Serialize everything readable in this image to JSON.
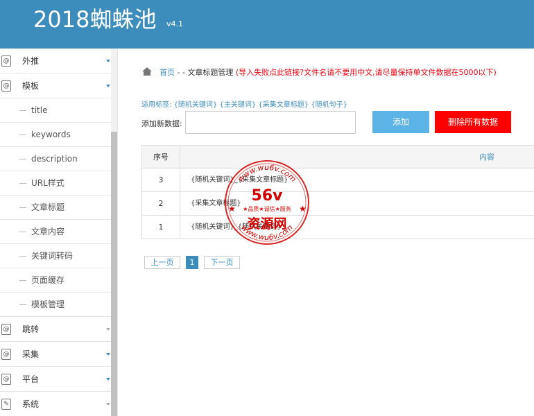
{
  "header": {
    "title": "2018蜘蛛池",
    "version": "v4.1"
  },
  "sidebar": {
    "items": [
      {
        "label": "外推"
      },
      {
        "label": "模板"
      },
      {
        "label": "跳转"
      },
      {
        "label": "采集"
      },
      {
        "label": "平台"
      },
      {
        "label": "系统"
      }
    ],
    "template_sub": [
      "title",
      "keywords",
      "description",
      "URL样式",
      "文章标题",
      "文章内容",
      "关键词转码",
      "页面缓存",
      "模板管理"
    ]
  },
  "breadcrumb": {
    "home": "首页",
    "sep": " - - ",
    "current": "文章标题管理",
    "note": " (导入失败点此链接?文件名请不要用中文,请尽量保持单文件数据在5000以下)"
  },
  "form": {
    "tags_label": "适用标签:",
    "tags": "{随机关键词} {主关键词} {采集文章标题} {随机句子}",
    "add_label": "添加新数据:",
    "add_value": "",
    "add_button": "添加",
    "delete_all_button": "删除所有数据"
  },
  "table": {
    "headers": [
      "序号",
      "内容"
    ],
    "rows": [
      {
        "id": "3",
        "content": "{随机关键词}_{采集文章标题}"
      },
      {
        "id": "2",
        "content": "{采集文章标题}"
      },
      {
        "id": "1",
        "content": "{随机关键词}_{随机关键词}"
      }
    ]
  },
  "pager": {
    "prev": "上一页",
    "current": "1",
    "next": "下一页"
  },
  "watermark": {
    "top_text": "www.wu6v.com",
    "center": "56v",
    "slogan": "★品质★诚信★服务",
    "name": "资源网",
    "bottom_text": "www.wu6v.com"
  },
  "colors": {
    "header_bg": "#3c8dbc",
    "link": "#3c8dbc",
    "add_button": "#5bb4e5",
    "delete_button": "#ff0000",
    "warning": "#ee1111"
  }
}
